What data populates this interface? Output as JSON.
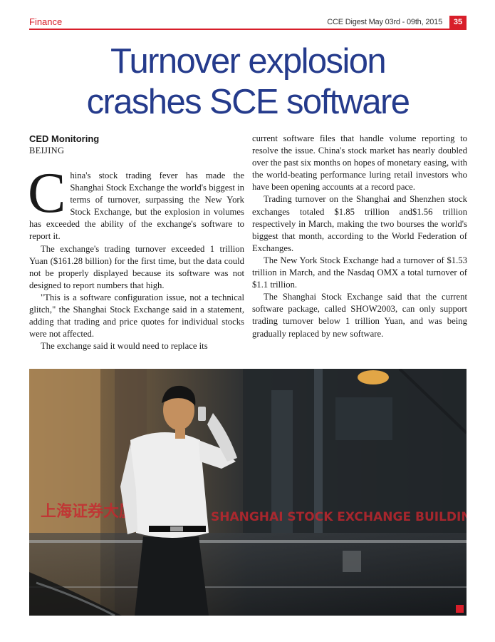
{
  "header": {
    "section": "Finance",
    "issue": "CCE Digest  May 03rd - 09th, 2015",
    "page_number": "35"
  },
  "article": {
    "headline_line1": "Turnover explosion",
    "headline_line2": "crashes SCE software",
    "byline": "CED Monitoring",
    "dateline": "BEIJING",
    "dropcap": "C",
    "left_paragraphs": [
      "hina's stock trading fever has made the Shanghai Stock Exchange the world's biggest in terms of turnover, surpassing the New York Stock Exchange, but the explosion in volumes has exceeded the ability of the exchange's software to report it.",
      "The exchange's trading turnover exceeded 1 trillion Yuan ($161.28 billion) for the first time, but the data could not be properly displayed because its software was not designed to report numbers that high.",
      "\"This is a software configuration issue, not a technical glitch,\" the Shanghai Stock Exchange said in a statement, adding that trading and price quotes for individual stocks were not affected.",
      "The exchange said it would need to replace its"
    ],
    "right_paragraphs": [
      "current software files that handle volume reporting to resolve the issue. China's stock market has nearly doubled over the past six months on hopes of monetary easing, with the world-beating performance luring retail investors who have been opening accounts at a record pace.",
      "Trading turnover on the Shanghai and Shenzhen stock exchanges totaled $1.85 trillion and$1.56 trillion respectively in March, making the two bourses the world's biggest that month, according to the World Federation of Exchanges.",
      "The New York Stock Exchange had a turnover of $1.53 trillion in March, and the Nasdaq OMX a total turnover of $1.1 trillion.",
      "The Shanghai Stock Exchange said that the current software package, called SHOW2003, can only support trading turnover below 1 trillion Yuan, and was being gradually replaced by new software."
    ]
  },
  "photo": {
    "sign_chinese": "上海证券大厦",
    "sign_english": "SHANGHAI STOCK EXCHANGE BUILDING"
  },
  "colors": {
    "accent_red": "#d81e2a",
    "headline_blue": "#253b8c"
  }
}
